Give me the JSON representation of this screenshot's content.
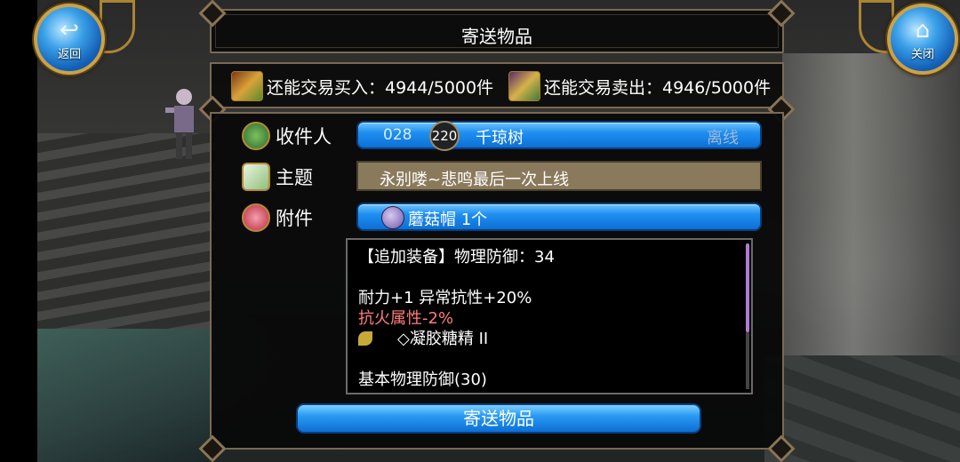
{
  "header": {
    "title": "寄送物品",
    "back_label": "返回",
    "close_label": "关闭"
  },
  "trade": {
    "buy_text": "还能交易买入：4944/5000件",
    "sell_text": "还能交易卖出：4946/5000件"
  },
  "recipient": {
    "label": "收件人",
    "id_number": "028",
    "level": "220",
    "name": "千琼树",
    "status": "离线"
  },
  "subject": {
    "label": "主题",
    "value": "永别喽~悲鸣最后一次上线"
  },
  "attachment": {
    "label": "附件",
    "value": "蘑菇帽 1个"
  },
  "item_description": {
    "line1": "【追加装备】物理防御：34",
    "line2": "",
    "line3": "耐力+1 异常抗性+20%",
    "line4": "抗火属性-2%",
    "line5": "◇凝胶糖精 II",
    "line6": "",
    "line7": "基本物理防御(30)"
  },
  "send_button_label": "寄送物品",
  "colors": {
    "accent_blue": "#1f8ff0",
    "frame_gold": "#7a6a52",
    "negative_stat": "#ff7d7d",
    "subject_field": "#8a7a5c"
  }
}
